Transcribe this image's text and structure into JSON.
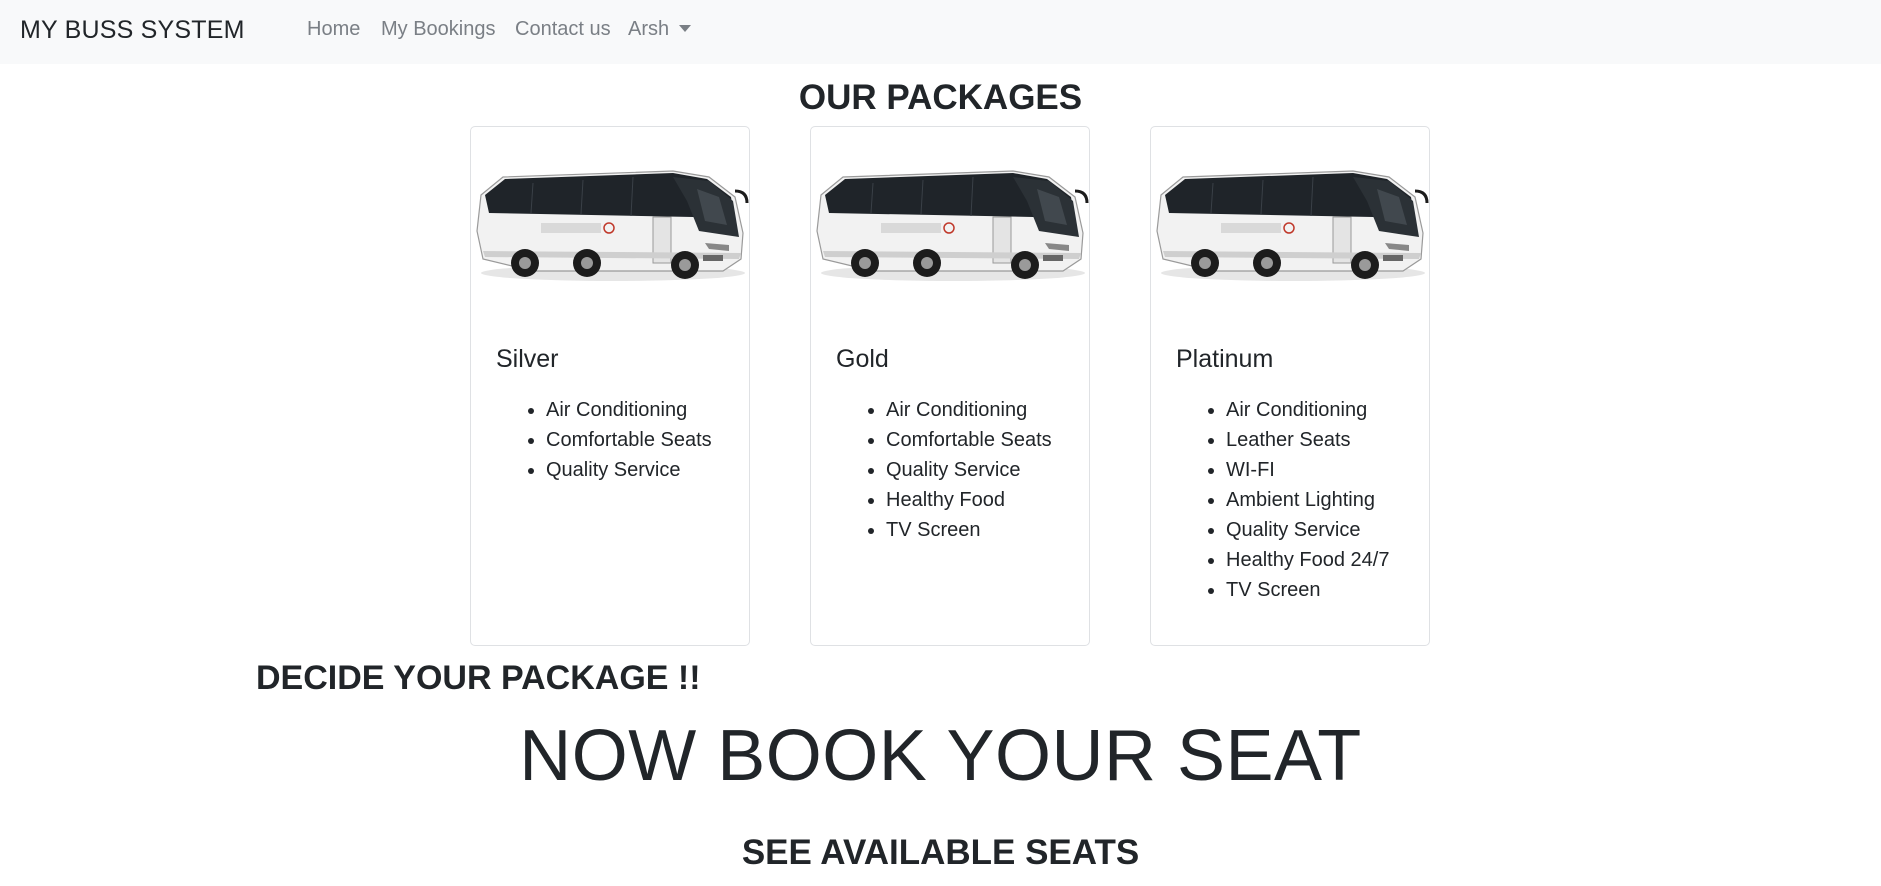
{
  "navbar": {
    "brand": "MY BUSS SYSTEM",
    "links": [
      "Home",
      "My Bookings",
      "Contact us"
    ],
    "user": "Arsh"
  },
  "packages": {
    "title": "OUR PACKAGES",
    "cards": [
      {
        "name": "Silver",
        "image": "bus-image",
        "features": [
          "Air Conditioning",
          "Comfortable Seats",
          "Quality Service"
        ]
      },
      {
        "name": "Gold",
        "image": "bus-image",
        "features": [
          "Air Conditioning",
          "Comfortable Seats",
          "Quality Service",
          "Healthy Food",
          "TV Screen"
        ]
      },
      {
        "name": "Platinum",
        "image": "bus-image",
        "features": [
          "Air Conditioning",
          "Leather Seats",
          "WI-FI",
          "Ambient Lighting",
          "Quality Service",
          "Healthy Food 24/7",
          "TV Screen"
        ]
      }
    ]
  },
  "decide": "DECIDE YOUR PACKAGE !!",
  "book_heading": "NOW BOOK YOUR SEAT",
  "see_seats": "SEE AVAILABLE SEATS"
}
